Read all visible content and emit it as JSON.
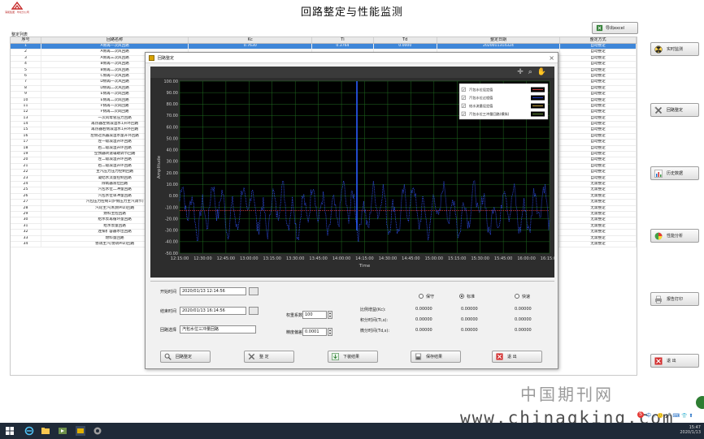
{
  "app": {
    "logo_text": "润和集团 · 华北分公司",
    "title": "回路整定与性能监测",
    "export_label": "导出excel"
  },
  "table": {
    "title": "整定列表",
    "columns": [
      "序号",
      "回路名称",
      "Kc",
      "Ti",
      "Td",
      "整定日期",
      "整定方式"
    ],
    "rows": [
      [
        "1",
        "A侧再一次风回路",
        "0.7630",
        "0.3764",
        "0.0000",
        "2020011314324",
        "自动整定"
      ],
      [
        "2",
        "A侧再二次风回路",
        "",
        "",
        "",
        "",
        "自动整定"
      ],
      [
        "3",
        "A侧再三次风回路",
        "",
        "",
        "",
        "",
        "自动整定"
      ],
      [
        "4",
        "B侧再一次风回路",
        "",
        "",
        "",
        "",
        "自动整定"
      ],
      [
        "5",
        "B侧再二次风回路",
        "",
        "",
        "",
        "",
        "自动整定"
      ],
      [
        "6",
        "C侧再一次风回路",
        "",
        "",
        "",
        "",
        "自动整定"
      ],
      [
        "7",
        "D侧再一次风回路",
        "",
        "",
        "",
        "",
        "自动整定"
      ],
      [
        "8",
        "D侧再二次风回路",
        "",
        "",
        "",
        "",
        "自动整定"
      ],
      [
        "9",
        "E侧再一次风回路",
        "",
        "",
        "",
        "",
        "自动整定"
      ],
      [
        "10",
        "E侧再二次风回路",
        "",
        "",
        "",
        "",
        "自动整定"
      ],
      [
        "11",
        "F侧再一次风回路",
        "",
        "",
        "",
        "",
        "自动整定"
      ],
      [
        "12",
        "F侧再二次风回路",
        "",
        "",
        "",
        "",
        "自动整定"
      ],
      [
        "13",
        "一次风母管压力回路",
        "",
        "",
        "",
        "",
        "自动整定"
      ],
      [
        "14",
        "再热器左侧减温水1开环回路",
        "",
        "",
        "",
        "",
        "自动整定"
      ],
      [
        "15",
        "再热器右侧减温水1开环回路",
        "",
        "",
        "",
        "",
        "自动整定"
      ],
      [
        "16",
        "左侧过热器减温水量开环回路",
        "",
        "",
        "",
        "",
        "自动整定"
      ],
      [
        "17",
        "左一级减温开环回路",
        "",
        "",
        "",
        "",
        "自动整定"
      ],
      [
        "18",
        "右二级减温开环回路",
        "",
        "",
        "",
        "",
        "自动整定"
      ],
      [
        "19",
        "空预器转速辅助调节回路",
        "",
        "",
        "",
        "",
        "自动整定"
      ],
      [
        "20",
        "左二级减温开环回路",
        "",
        "",
        "",
        "",
        "自动整定"
      ],
      [
        "21",
        "右二级减温开环回路",
        "",
        "",
        "",
        "",
        "自动整定"
      ],
      [
        "22",
        "主汽压力压力控制回路",
        "",
        "",
        "",
        "",
        "自动整定"
      ],
      [
        "23",
        "凝结水流量控制回路",
        "",
        "",
        "",
        "",
        "自动整定"
      ],
      [
        "24",
        "除氧器液位回路",
        "",
        "",
        "",
        "",
        "无需整定"
      ],
      [
        "25",
        "汽包水位二冲量回路",
        "",
        "",
        "",
        "",
        "无需整定"
      ],
      [
        "26",
        "汽包水位单冲量回路",
        "",
        "",
        "",
        "",
        "无需整定"
      ],
      [
        "27",
        "汽包压力控制1(炉侧压力主汽调节)",
        "",
        "",
        "",
        "",
        "无需整定"
      ],
      [
        "28",
        "汽轮主汽(机侧PID)回路",
        "",
        "",
        "",
        "",
        "无需整定"
      ],
      [
        "29",
        "燃料主控回路",
        "",
        "",
        "",
        "",
        "无需整定"
      ],
      [
        "30",
        "给水泵再循环量回路",
        "",
        "",
        "",
        "",
        "无需整定"
      ],
      [
        "31",
        "给水泵量回路",
        "",
        "",
        "",
        "",
        "无需整定"
      ],
      [
        "32",
        "连排扩容器水位回路",
        "",
        "",
        "",
        "",
        "无需整定"
      ],
      [
        "33",
        "燃料量回路",
        "",
        "",
        "",
        "",
        "无需整定"
      ],
      [
        "34",
        "协调主汽(协调PID)回路",
        "",
        "",
        "",
        "",
        "无需整定"
      ]
    ]
  },
  "side_buttons": [
    {
      "label": "实时监测",
      "icon": "radiation-icon"
    },
    {
      "label": "回路整定",
      "icon": "tools-icon"
    },
    {
      "label": "历史数据",
      "icon": "chart-icon"
    },
    {
      "label": "性能分析",
      "icon": "pie-icon"
    },
    {
      "label": "报告打印",
      "icon": "printer-icon"
    },
    {
      "label": "退 出",
      "icon": "close-icon"
    }
  ],
  "dialog": {
    "title": "回路整定",
    "close": "×",
    "toolbar_icons": [
      "✛",
      "⌕",
      "✋"
    ],
    "start_label": "开始时间",
    "start_value": "2020/01/13 12:14:56",
    "end_label": "结束时间",
    "end_value": "2020/01/13 16:14:56",
    "loop_label": "回路选择",
    "loop_value": "汽包水位三冲量回路",
    "weight_label": "权重系数",
    "weight_value": "100",
    "precision_label": "精度偏差",
    "precision_value": "0.0001",
    "modes": [
      {
        "label": "保守",
        "selected": false
      },
      {
        "label": "标准",
        "selected": true
      },
      {
        "label": "快速",
        "selected": false
      }
    ],
    "params": [
      {
        "label": "比例增益(Kc):",
        "values": [
          "0.00000",
          "0.00000",
          "0.00000"
        ]
      },
      {
        "label": "积分时间(Ti,s):",
        "values": [
          "0.00000",
          "0.00000",
          "0.00000"
        ]
      },
      {
        "label": "微分时间(Td,s):",
        "values": [
          "0.00000",
          "0.00000",
          "0.00000"
        ]
      }
    ],
    "buttons": [
      {
        "label": "回路整定",
        "icon": "magnify-icon"
      },
      {
        "label": "整 定",
        "icon": "tools-icon"
      },
      {
        "label": "下装结果",
        "icon": "download-icon"
      },
      {
        "label": "保存结果",
        "icon": "save-icon"
      },
      {
        "label": "退 出",
        "icon": "close-icon"
      }
    ]
  },
  "chart_data": {
    "type": "line",
    "title": "",
    "xlabel": "Time",
    "ylabel": "Amplitude",
    "ylim": [
      -50,
      100
    ],
    "yticks": [
      "100.00",
      "90.00",
      "80.00",
      "70.00",
      "60.00",
      "50.00",
      "40.00",
      "30.00",
      "20.00",
      "10.00",
      "0.00",
      "-10.00",
      "-20.00",
      "-30.00",
      "-40.00",
      "-50.00"
    ],
    "xticks": [
      "12:15:00",
      "12:30:00",
      "12:45:00",
      "13:00:00",
      "13:15:00",
      "13:30:00",
      "13:45:00",
      "14:00:00",
      "14:15:00",
      "14:30:00",
      "14:45:00",
      "15:00:00",
      "15:15:00",
      "15:30:00",
      "15:45:00",
      "16:00:00",
      "16:15:00"
    ],
    "grid": true,
    "legend_position": "top-right",
    "series": [
      {
        "name": "汽包水位设定值",
        "color": "#ff4d4d",
        "constant": -13
      },
      {
        "name": "汽包水位过程值",
        "color": "#3355ff"
      },
      {
        "name": "给水流量设定值",
        "color": "#ffd54f"
      },
      {
        "name": "汽包水位三冲量回路(模拟)",
        "color": "#7cb342"
      }
    ],
    "spike_time": "14:10:00",
    "spike_value": 100
  },
  "watermark": {
    "cn": "中国期刊网",
    "url": "www.chinaqking.com"
  },
  "ime": {
    "text": "中 ·,  🙂 🎤 ⌨ 👕 ⬆"
  },
  "taskbar": {
    "clock": "15:47\n2020/1/13"
  }
}
